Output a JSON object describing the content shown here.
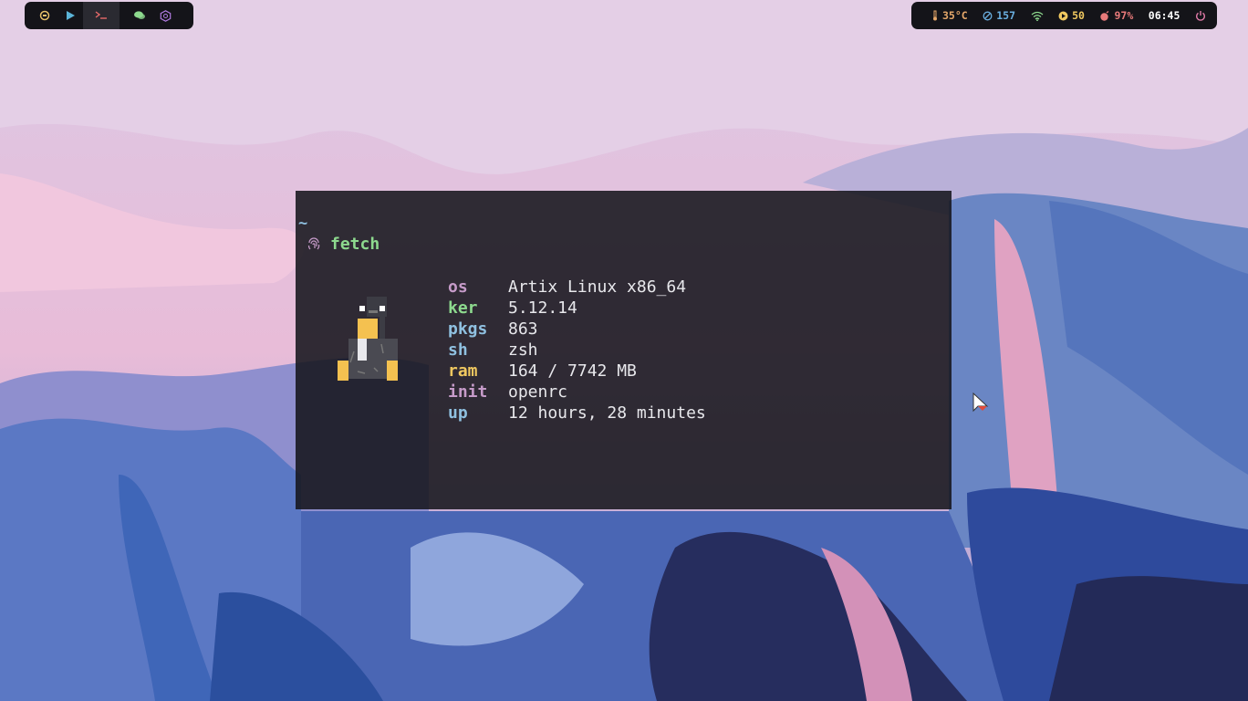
{
  "topbar_left": {
    "workspaces": [
      {
        "icon": "circle-face-icon",
        "color": "#e6c06a"
      },
      {
        "icon": "play-icon",
        "color": "#5bb4d8"
      },
      {
        "icon": "terminal-icon",
        "color": "#e76a6a",
        "active": true
      },
      {
        "icon": "chat-icon",
        "color": "#8dd98e"
      },
      {
        "icon": "hexagon-icon",
        "color": "#b07be0"
      }
    ]
  },
  "topbar_right": {
    "temperature": "35°C",
    "updates": "157",
    "wifi_icon": "wifi-icon",
    "volume": "50",
    "battery": "97%",
    "clock": "06:45",
    "colors": {
      "temperature": "#e6a86a",
      "updates": "#6aaedf",
      "wifi": "#8dd98e",
      "volume": "#f0c860",
      "battery": "#e87a7a",
      "clock": "#ffffff",
      "power": "#e07aa8"
    }
  },
  "terminal": {
    "cwd": "~",
    "prompt_icon": "fingerprint-icon",
    "command": "fetch",
    "info": [
      {
        "key": "os",
        "value": "Artix Linux x86_64",
        "color": "#c69bc9"
      },
      {
        "key": "ker",
        "value": "5.12.14",
        "color": "#8dd98e"
      },
      {
        "key": "pkgs",
        "value": "863",
        "color": "#8fc0e0"
      },
      {
        "key": "sh",
        "value": "zsh",
        "color": "#8fc0e0"
      },
      {
        "key": "ram",
        "value": "164 / 7742 MB",
        "color": "#f0c860"
      },
      {
        "key": "init",
        "value": "openrc",
        "color": "#c69bc9"
      },
      {
        "key": "up",
        "value": "12 hours, 28 minutes",
        "color": "#8fc0e0"
      }
    ]
  }
}
